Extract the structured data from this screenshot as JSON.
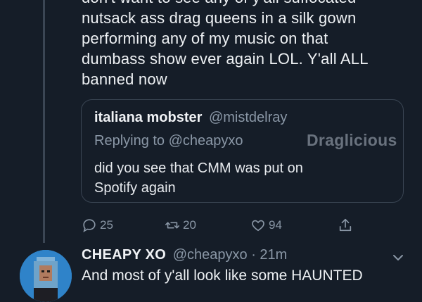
{
  "tweet": {
    "text": "don't want to see any of y'all suffocated\nnutsack ass drag queens in a silk gown\nperforming any of my music on that\ndumbass show ever again LOL. Y'all ALL\nbanned now"
  },
  "quote": {
    "name": "italiana mobster",
    "handle": "@mistdelray",
    "replying_to": "Replying to @cheapyxo",
    "text": "did you see that CMM was put on\nSpotify again"
  },
  "watermark": "Draglicious",
  "actions": {
    "reply_count": "25",
    "retweet_count": "20",
    "like_count": "94",
    "icons": [
      "reply-icon",
      "retweet-icon",
      "like-icon",
      "share-icon"
    ]
  },
  "next_tweet": {
    "name": "CHEAPY XO",
    "handle_time": "@cheapyxo · 21m",
    "text": "And most of y'all look like some HAUNTED"
  },
  "colors": {
    "background": "#151d28",
    "secondary_text": "#8a97a6",
    "border": "#3a4553",
    "avatar": "#2f83c9"
  }
}
